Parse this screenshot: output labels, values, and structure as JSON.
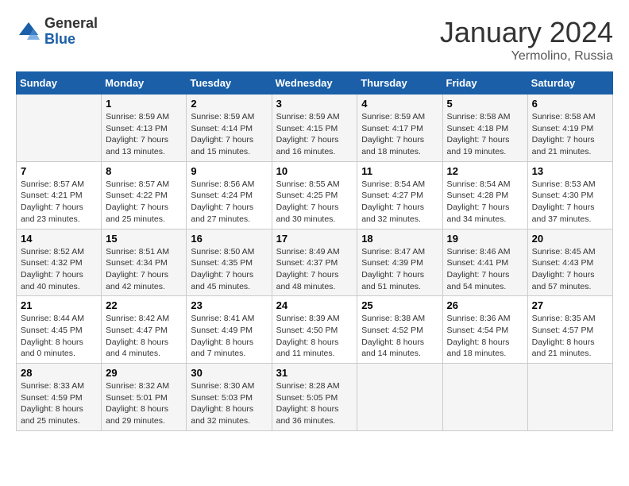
{
  "logo": {
    "general": "General",
    "blue": "Blue"
  },
  "title": "January 2024",
  "subtitle": "Yermolino, Russia",
  "days_header": [
    "Sunday",
    "Monday",
    "Tuesday",
    "Wednesday",
    "Thursday",
    "Friday",
    "Saturday"
  ],
  "weeks": [
    [
      {
        "day": "",
        "sunrise": "",
        "sunset": "",
        "daylight": ""
      },
      {
        "day": "1",
        "sunrise": "Sunrise: 8:59 AM",
        "sunset": "Sunset: 4:13 PM",
        "daylight": "Daylight: 7 hours and 13 minutes."
      },
      {
        "day": "2",
        "sunrise": "Sunrise: 8:59 AM",
        "sunset": "Sunset: 4:14 PM",
        "daylight": "Daylight: 7 hours and 15 minutes."
      },
      {
        "day": "3",
        "sunrise": "Sunrise: 8:59 AM",
        "sunset": "Sunset: 4:15 PM",
        "daylight": "Daylight: 7 hours and 16 minutes."
      },
      {
        "day": "4",
        "sunrise": "Sunrise: 8:59 AM",
        "sunset": "Sunset: 4:17 PM",
        "daylight": "Daylight: 7 hours and 18 minutes."
      },
      {
        "day": "5",
        "sunrise": "Sunrise: 8:58 AM",
        "sunset": "Sunset: 4:18 PM",
        "daylight": "Daylight: 7 hours and 19 minutes."
      },
      {
        "day": "6",
        "sunrise": "Sunrise: 8:58 AM",
        "sunset": "Sunset: 4:19 PM",
        "daylight": "Daylight: 7 hours and 21 minutes."
      }
    ],
    [
      {
        "day": "7",
        "sunrise": "Sunrise: 8:57 AM",
        "sunset": "Sunset: 4:21 PM",
        "daylight": "Daylight: 7 hours and 23 minutes."
      },
      {
        "day": "8",
        "sunrise": "Sunrise: 8:57 AM",
        "sunset": "Sunset: 4:22 PM",
        "daylight": "Daylight: 7 hours and 25 minutes."
      },
      {
        "day": "9",
        "sunrise": "Sunrise: 8:56 AM",
        "sunset": "Sunset: 4:24 PM",
        "daylight": "Daylight: 7 hours and 27 minutes."
      },
      {
        "day": "10",
        "sunrise": "Sunrise: 8:55 AM",
        "sunset": "Sunset: 4:25 PM",
        "daylight": "Daylight: 7 hours and 30 minutes."
      },
      {
        "day": "11",
        "sunrise": "Sunrise: 8:54 AM",
        "sunset": "Sunset: 4:27 PM",
        "daylight": "Daylight: 7 hours and 32 minutes."
      },
      {
        "day": "12",
        "sunrise": "Sunrise: 8:54 AM",
        "sunset": "Sunset: 4:28 PM",
        "daylight": "Daylight: 7 hours and 34 minutes."
      },
      {
        "day": "13",
        "sunrise": "Sunrise: 8:53 AM",
        "sunset": "Sunset: 4:30 PM",
        "daylight": "Daylight: 7 hours and 37 minutes."
      }
    ],
    [
      {
        "day": "14",
        "sunrise": "Sunrise: 8:52 AM",
        "sunset": "Sunset: 4:32 PM",
        "daylight": "Daylight: 7 hours and 40 minutes."
      },
      {
        "day": "15",
        "sunrise": "Sunrise: 8:51 AM",
        "sunset": "Sunset: 4:34 PM",
        "daylight": "Daylight: 7 hours and 42 minutes."
      },
      {
        "day": "16",
        "sunrise": "Sunrise: 8:50 AM",
        "sunset": "Sunset: 4:35 PM",
        "daylight": "Daylight: 7 hours and 45 minutes."
      },
      {
        "day": "17",
        "sunrise": "Sunrise: 8:49 AM",
        "sunset": "Sunset: 4:37 PM",
        "daylight": "Daylight: 7 hours and 48 minutes."
      },
      {
        "day": "18",
        "sunrise": "Sunrise: 8:47 AM",
        "sunset": "Sunset: 4:39 PM",
        "daylight": "Daylight: 7 hours and 51 minutes."
      },
      {
        "day": "19",
        "sunrise": "Sunrise: 8:46 AM",
        "sunset": "Sunset: 4:41 PM",
        "daylight": "Daylight: 7 hours and 54 minutes."
      },
      {
        "day": "20",
        "sunrise": "Sunrise: 8:45 AM",
        "sunset": "Sunset: 4:43 PM",
        "daylight": "Daylight: 7 hours and 57 minutes."
      }
    ],
    [
      {
        "day": "21",
        "sunrise": "Sunrise: 8:44 AM",
        "sunset": "Sunset: 4:45 PM",
        "daylight": "Daylight: 8 hours and 0 minutes."
      },
      {
        "day": "22",
        "sunrise": "Sunrise: 8:42 AM",
        "sunset": "Sunset: 4:47 PM",
        "daylight": "Daylight: 8 hours and 4 minutes."
      },
      {
        "day": "23",
        "sunrise": "Sunrise: 8:41 AM",
        "sunset": "Sunset: 4:49 PM",
        "daylight": "Daylight: 8 hours and 7 minutes."
      },
      {
        "day": "24",
        "sunrise": "Sunrise: 8:39 AM",
        "sunset": "Sunset: 4:50 PM",
        "daylight": "Daylight: 8 hours and 11 minutes."
      },
      {
        "day": "25",
        "sunrise": "Sunrise: 8:38 AM",
        "sunset": "Sunset: 4:52 PM",
        "daylight": "Daylight: 8 hours and 14 minutes."
      },
      {
        "day": "26",
        "sunrise": "Sunrise: 8:36 AM",
        "sunset": "Sunset: 4:54 PM",
        "daylight": "Daylight: 8 hours and 18 minutes."
      },
      {
        "day": "27",
        "sunrise": "Sunrise: 8:35 AM",
        "sunset": "Sunset: 4:57 PM",
        "daylight": "Daylight: 8 hours and 21 minutes."
      }
    ],
    [
      {
        "day": "28",
        "sunrise": "Sunrise: 8:33 AM",
        "sunset": "Sunset: 4:59 PM",
        "daylight": "Daylight: 8 hours and 25 minutes."
      },
      {
        "day": "29",
        "sunrise": "Sunrise: 8:32 AM",
        "sunset": "Sunset: 5:01 PM",
        "daylight": "Daylight: 8 hours and 29 minutes."
      },
      {
        "day": "30",
        "sunrise": "Sunrise: 8:30 AM",
        "sunset": "Sunset: 5:03 PM",
        "daylight": "Daylight: 8 hours and 32 minutes."
      },
      {
        "day": "31",
        "sunrise": "Sunrise: 8:28 AM",
        "sunset": "Sunset: 5:05 PM",
        "daylight": "Daylight: 8 hours and 36 minutes."
      },
      {
        "day": "",
        "sunrise": "",
        "sunset": "",
        "daylight": ""
      },
      {
        "day": "",
        "sunrise": "",
        "sunset": "",
        "daylight": ""
      },
      {
        "day": "",
        "sunrise": "",
        "sunset": "",
        "daylight": ""
      }
    ]
  ]
}
